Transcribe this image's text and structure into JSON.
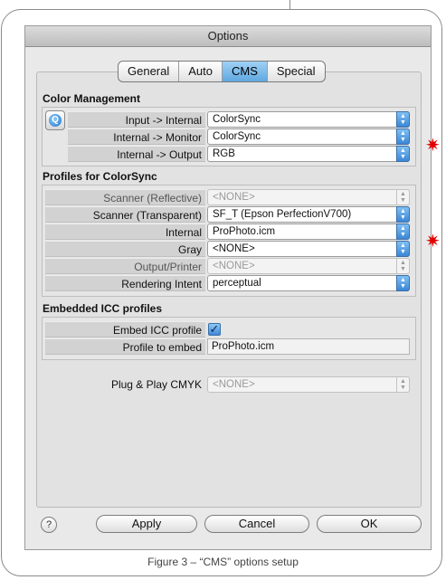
{
  "window": {
    "title": "Options"
  },
  "tabs": [
    "General",
    "Auto",
    "CMS",
    "Special"
  ],
  "active_tab": "CMS",
  "color_management": {
    "title": "Color Management",
    "rows": [
      {
        "label": "Input -> Internal",
        "value": "ColorSync"
      },
      {
        "label": "Internal -> Monitor",
        "value": "ColorSync"
      },
      {
        "label": "Internal -> Output",
        "value": "RGB"
      }
    ]
  },
  "profiles": {
    "title": "Profiles for ColorSync",
    "rows": [
      {
        "label": "Scanner (Reflective)",
        "value": "<NONE>"
      },
      {
        "label": "Scanner (Transparent)",
        "value": "SF_T (Epson PerfectionV700)"
      },
      {
        "label": "Internal",
        "value": "ProPhoto.icm"
      },
      {
        "label": "Gray",
        "value": "<NONE>"
      },
      {
        "label": "Output/Printer",
        "value": "<NONE>"
      },
      {
        "label": "Rendering Intent",
        "value": "perceptual"
      }
    ]
  },
  "embedded": {
    "title": "Embedded ICC profiles",
    "embed_label": "Embed ICC profile",
    "embed_checked": true,
    "profile_label": "Profile to embed",
    "profile_value": "ProPhoto.icm"
  },
  "plug_play": {
    "label": "Plug & Play CMYK",
    "value": "<NONE>"
  },
  "buttons": {
    "apply": "Apply",
    "cancel": "Cancel",
    "ok": "OK"
  },
  "marker_glyph": "✷",
  "caption": "Figure 3 – “CMS” options setup",
  "colors": {
    "accent": "#4d9be3",
    "marker": "#e00000"
  },
  "icons": [
    "quick-settings-icon",
    "help-icon",
    "checkmark-icon",
    "asterisk-icon"
  ]
}
